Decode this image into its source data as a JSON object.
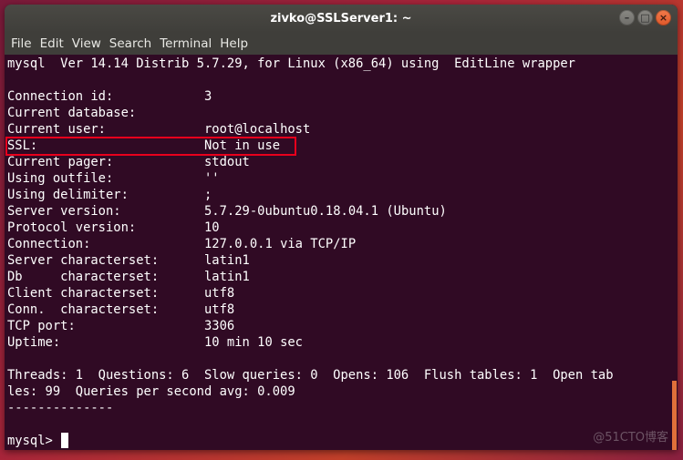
{
  "window": {
    "title": "zivko@SSLServer1: ~",
    "buttons": {
      "minimize": "–",
      "maximize": "□",
      "close": "×"
    }
  },
  "menubar": [
    "File",
    "Edit",
    "View",
    "Search",
    "Terminal",
    "Help"
  ],
  "terminal": {
    "version_line": "mysql  Ver 14.14 Distrib 5.7.29, for Linux (x86_64) using  EditLine wrapper",
    "status": [
      {
        "label": "Connection id:",
        "value": "3"
      },
      {
        "label": "Current database:",
        "value": ""
      },
      {
        "label": "Current user:",
        "value": "root@localhost"
      },
      {
        "label": "SSL:",
        "value": "Not in use"
      },
      {
        "label": "Current pager:",
        "value": "stdout"
      },
      {
        "label": "Using outfile:",
        "value": "''"
      },
      {
        "label": "Using delimiter:",
        "value": ";"
      },
      {
        "label": "Server version:",
        "value": "5.7.29-0ubuntu0.18.04.1 (Ubuntu)"
      },
      {
        "label": "Protocol version:",
        "value": "10"
      },
      {
        "label": "Connection:",
        "value": "127.0.0.1 via TCP/IP"
      },
      {
        "label": "Server characterset:",
        "value": "latin1"
      },
      {
        "label": "Db     characterset:",
        "value": "latin1"
      },
      {
        "label": "Client characterset:",
        "value": "utf8"
      },
      {
        "label": "Conn.  characterset:",
        "value": "utf8"
      },
      {
        "label": "TCP port:",
        "value": "3306"
      },
      {
        "label": "Uptime:",
        "value": "10 min 10 sec"
      }
    ],
    "stats_line1": "Threads: 1  Questions: 6  Slow queries: 0  Opens: 106  Flush tables: 1  Open tab",
    "stats_line2": "les: 99  Queries per second avg: 0.009",
    "separator": "--------------",
    "prompt": "mysql> "
  },
  "highlight": {
    "field": "SSL",
    "color": "#e8001c"
  },
  "colors": {
    "terminal_bg": "#300a24",
    "titlebar_bg": "#3f3e3a",
    "close_button": "#e95420",
    "scrollbar": "#e0703a"
  },
  "watermark": "@51CTO博客"
}
